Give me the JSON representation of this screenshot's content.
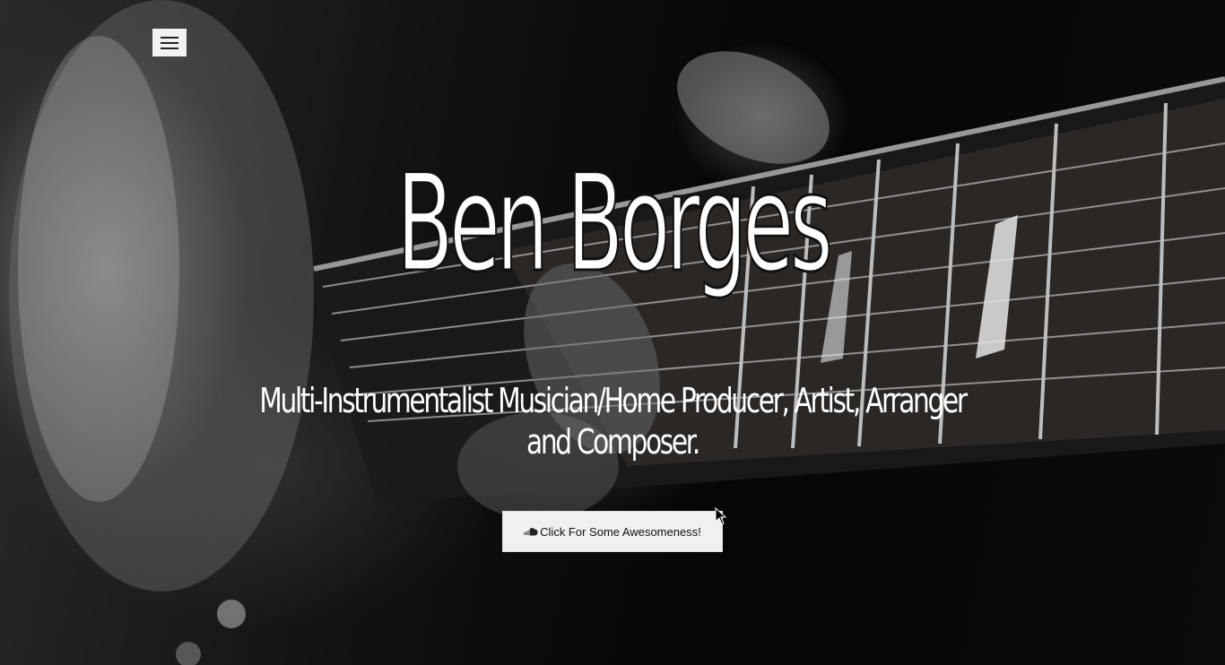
{
  "header": {
    "menu_icon": "hamburger-icon"
  },
  "hero": {
    "title": "Ben Borges",
    "tagline": "Multi-Instrumentalist Musician/Home Producer, Artist, Arranger and Composer.",
    "cta_label": "Click For Some Awesomeness!",
    "cta_icon": "soundcloud-icon",
    "background_image": "guitar-fretboard-photo",
    "text_color": "#ffffff",
    "button_bg": "#f0f0f0"
  }
}
